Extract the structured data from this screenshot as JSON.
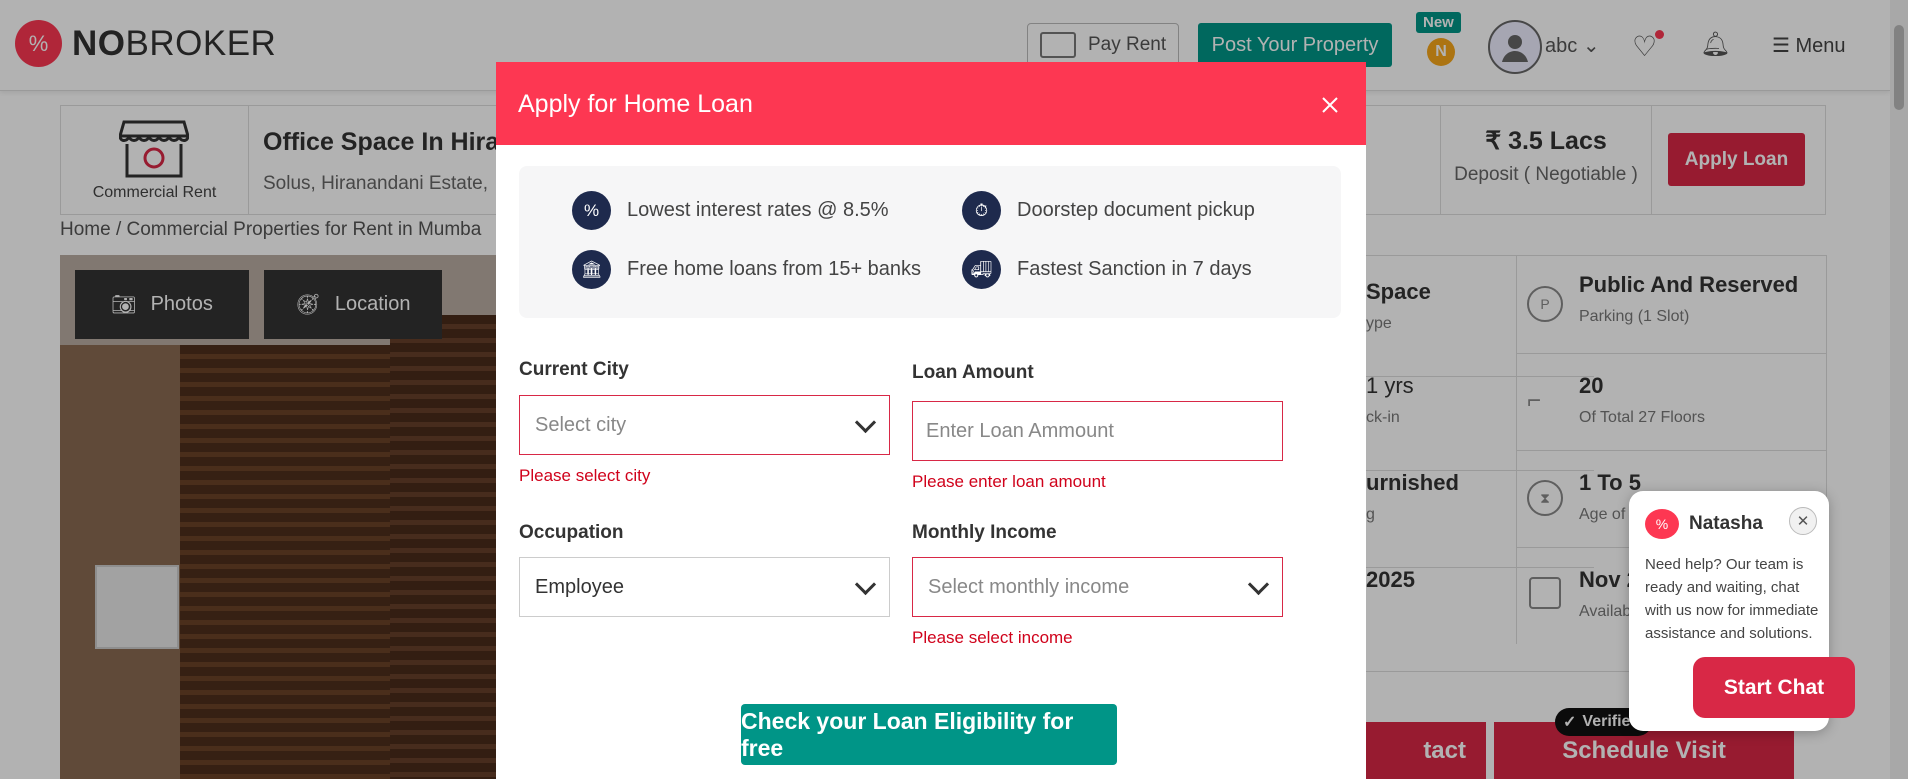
{
  "header": {
    "logo_no": "NO",
    "logo_broker": "BROKER",
    "pay_rent_label": "Pay Rent",
    "post_property_label": "Post Your Property",
    "new_badge": "New",
    "coin_letter": "N",
    "user_name": "abc",
    "menu_label": "Menu"
  },
  "property": {
    "category_label": "Commercial Rent",
    "title": "Office Space In Hiran",
    "subtitle": "Solus, Hiranandani Estate,",
    "deposit_value": "₹ 3.5 Lacs",
    "deposit_label": "Deposit ( Negotiable )",
    "apply_loan_label": "Apply Loan",
    "breadcrumb": "Home / Commercial Properties for Rent in Mumba"
  },
  "gallery": {
    "photos_label": "Photos",
    "location_label": "Location"
  },
  "details": {
    "type_value": "Space",
    "type_label": "ype",
    "parking_value": "Public And Reserved",
    "parking_label": "Parking  (1 Slot)",
    "lockin_value": "1 yrs",
    "lockin_label": "ck-in",
    "floor_value": "20",
    "floor_label": "Of Total 27 Floors",
    "furnish_value": "urnished",
    "furnish_label": "g",
    "age_value": "1 To 5",
    "age_label": "Age of B",
    "date_value": "2025",
    "avail_value": "Nov 2",
    "avail_label": "Availab"
  },
  "actions": {
    "contact_label": "tact",
    "schedule_label": "Schedule Visit",
    "verified_label": "Verified"
  },
  "chat": {
    "agent_name": "Natasha",
    "message": "Need help? Our team is ready and waiting, chat with us now for immediate assistance and solutions.",
    "start_label": "Start Chat"
  },
  "modal": {
    "title": "Apply for Home Loan",
    "features": [
      {
        "icon": "percent-icon",
        "text": "Lowest interest rates @ 8.5%"
      },
      {
        "icon": "document-clock-icon",
        "text": "Doorstep document pickup"
      },
      {
        "icon": "bank-icon",
        "text": "Free home loans from 15+ banks"
      },
      {
        "icon": "truck-icon",
        "text": "Fastest Sanction in 7 days"
      }
    ],
    "city": {
      "label": "Current City",
      "placeholder": "Select city",
      "error": "Please select city"
    },
    "loan": {
      "label": "Loan Amount",
      "placeholder": "Enter Loan Ammount",
      "error": "Please enter loan amount"
    },
    "occupation": {
      "label": "Occupation",
      "value": "Employee"
    },
    "income": {
      "label": "Monthly Income",
      "placeholder": "Select monthly income",
      "error": "Please select income"
    },
    "submit_label": "Check your Loan Eligibility for free"
  },
  "colors": {
    "brand_red": "#fd3752",
    "action_red": "#d82846",
    "teal": "#009587",
    "navy": "#1e2a4d"
  }
}
